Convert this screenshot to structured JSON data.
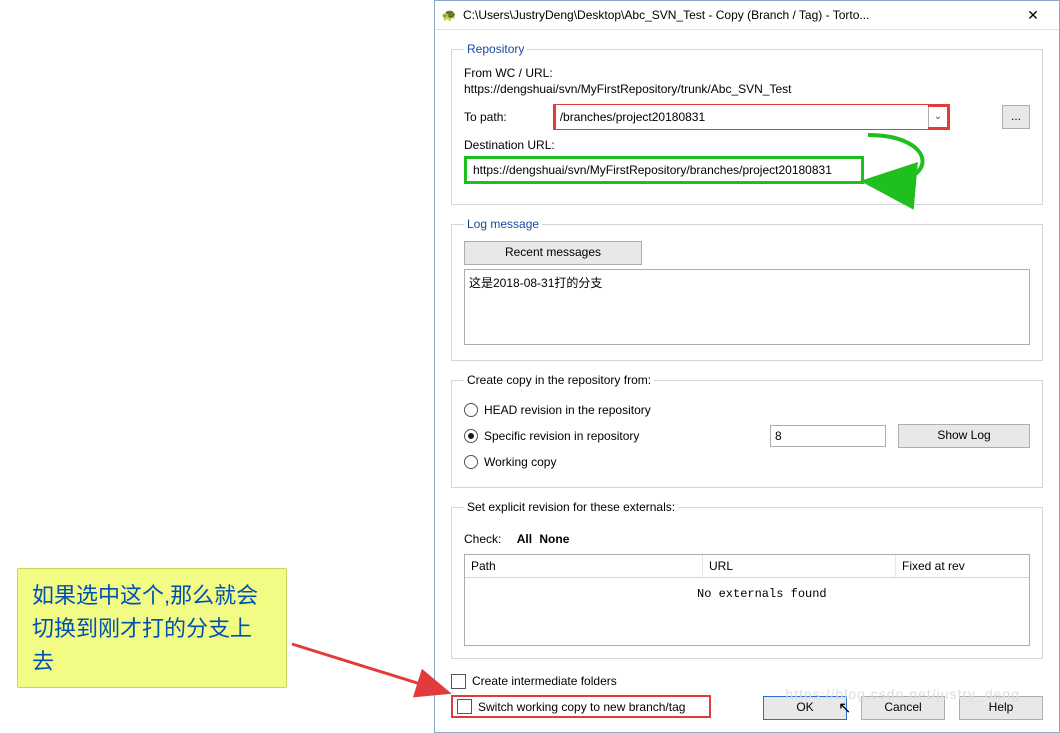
{
  "titlebar": {
    "icon": "🐢",
    "title": "C:\\Users\\JustryDeng\\Desktop\\Abc_SVN_Test - Copy (Branch / Tag) - Torto..."
  },
  "repository": {
    "legend": "Repository",
    "from_label": "From WC / URL:",
    "from_url": "https://dengshuai/svn/MyFirstRepository/trunk/Abc_SVN_Test",
    "to_label": "To path:",
    "to_value": "/branches/project20180831",
    "browse_label": "...",
    "dest_label": "Destination URL:",
    "dest_url": "https://dengshuai/svn/MyFirstRepository/branches/project20180831"
  },
  "log": {
    "legend": "Log message",
    "recent_label": "Recent messages",
    "text": "这是2018-08-31打的分支"
  },
  "create": {
    "legend": "Create copy in the repository from:",
    "opt_head": "HEAD revision in the repository",
    "opt_specific": "Specific revision in repository",
    "rev_value": "8",
    "showlog_label": "Show Log",
    "opt_wc": "Working copy"
  },
  "externals": {
    "legend": "Set explicit revision for these externals:",
    "check_label": "Check:",
    "all": "All",
    "none": "None",
    "col_path": "Path",
    "col_url": "URL",
    "col_fixed": "Fixed at rev",
    "empty": "No externals found"
  },
  "options": {
    "create_intermediate": "Create intermediate folders",
    "switch_wc": "Switch working copy to new branch/tag"
  },
  "buttons": {
    "ok": "OK",
    "cancel": "Cancel",
    "help": "Help"
  },
  "annotation": {
    "text": "如果选中这个,那么就会切换到刚才打的分支上去"
  },
  "watermark": "https://blog.csdn.net/justry_deng"
}
